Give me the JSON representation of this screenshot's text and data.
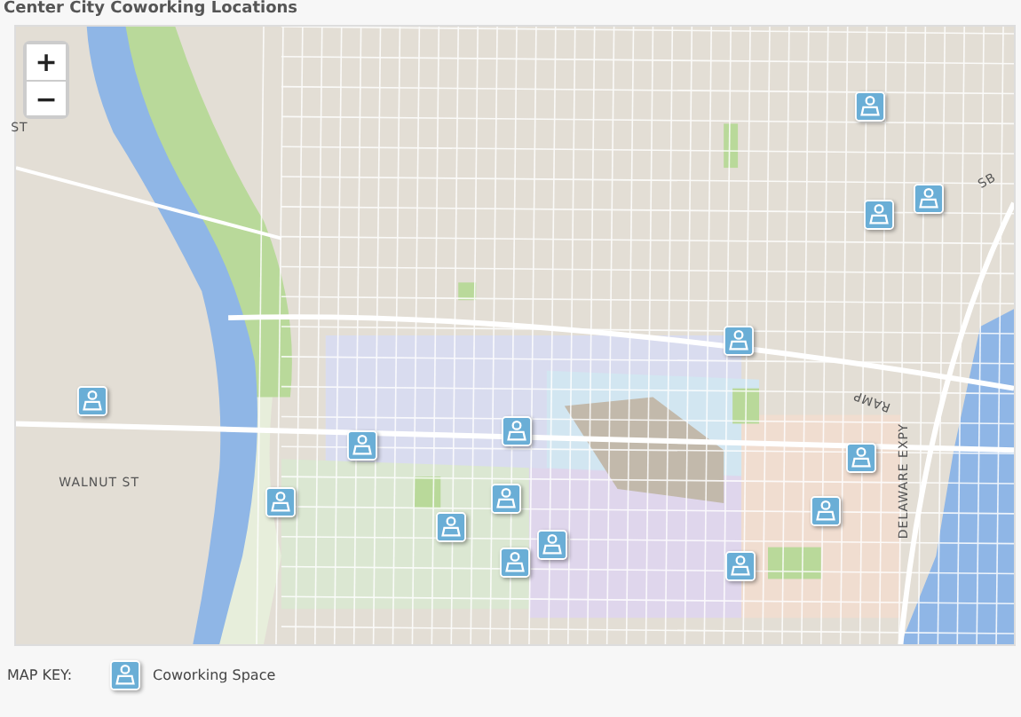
{
  "title": "Center City Coworking Locations",
  "map": {
    "zoom_in": "+",
    "zoom_out": "−",
    "street_labels": [
      {
        "text": "ST"
      },
      {
        "text": "WALNUT ST"
      },
      {
        "text": "SB"
      },
      {
        "text": "RAMP"
      },
      {
        "text": "DELAWARE EXPY"
      }
    ],
    "markers": [
      {
        "kind": "coworking"
      },
      {
        "kind": "coworking"
      },
      {
        "kind": "coworking"
      },
      {
        "kind": "coworking"
      },
      {
        "kind": "coworking"
      },
      {
        "kind": "coworking"
      },
      {
        "kind": "coworking"
      },
      {
        "kind": "coworking"
      },
      {
        "kind": "coworking"
      },
      {
        "kind": "coworking"
      },
      {
        "kind": "coworking"
      },
      {
        "kind": "coworking"
      },
      {
        "kind": "coworking"
      },
      {
        "kind": "coworking"
      },
      {
        "kind": "coworking"
      }
    ]
  },
  "map_key": {
    "label": "MAP KEY:",
    "items": [
      {
        "kind": "coworking",
        "text": "Coworking Space"
      }
    ]
  }
}
